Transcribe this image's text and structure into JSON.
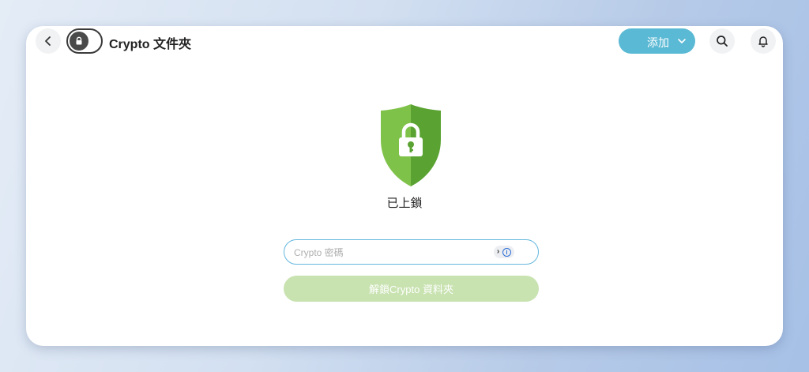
{
  "header": {
    "title": "Crypto 文件夾",
    "add_label": "添加"
  },
  "icons": {
    "back": "chevron-left-icon",
    "lock_toggle": "lock-icon",
    "add_dropdown": "chevron-down-icon",
    "search": "search-icon",
    "notifications": "bell-icon",
    "status": "shield-lock-icon",
    "password_helper": "password-manager-icon"
  },
  "status": {
    "text": "已上鎖"
  },
  "password": {
    "placeholder": "Crypto 密碼",
    "value": ""
  },
  "unlock_button": {
    "label": "解鎖Crypto 資料夾"
  },
  "colors": {
    "accent": "#5ab9d4",
    "shield_light": "#7fc24a",
    "shield_dark": "#5aa332",
    "unlock_disabled": "#c8e2b0",
    "input_border": "#64b7dd"
  }
}
